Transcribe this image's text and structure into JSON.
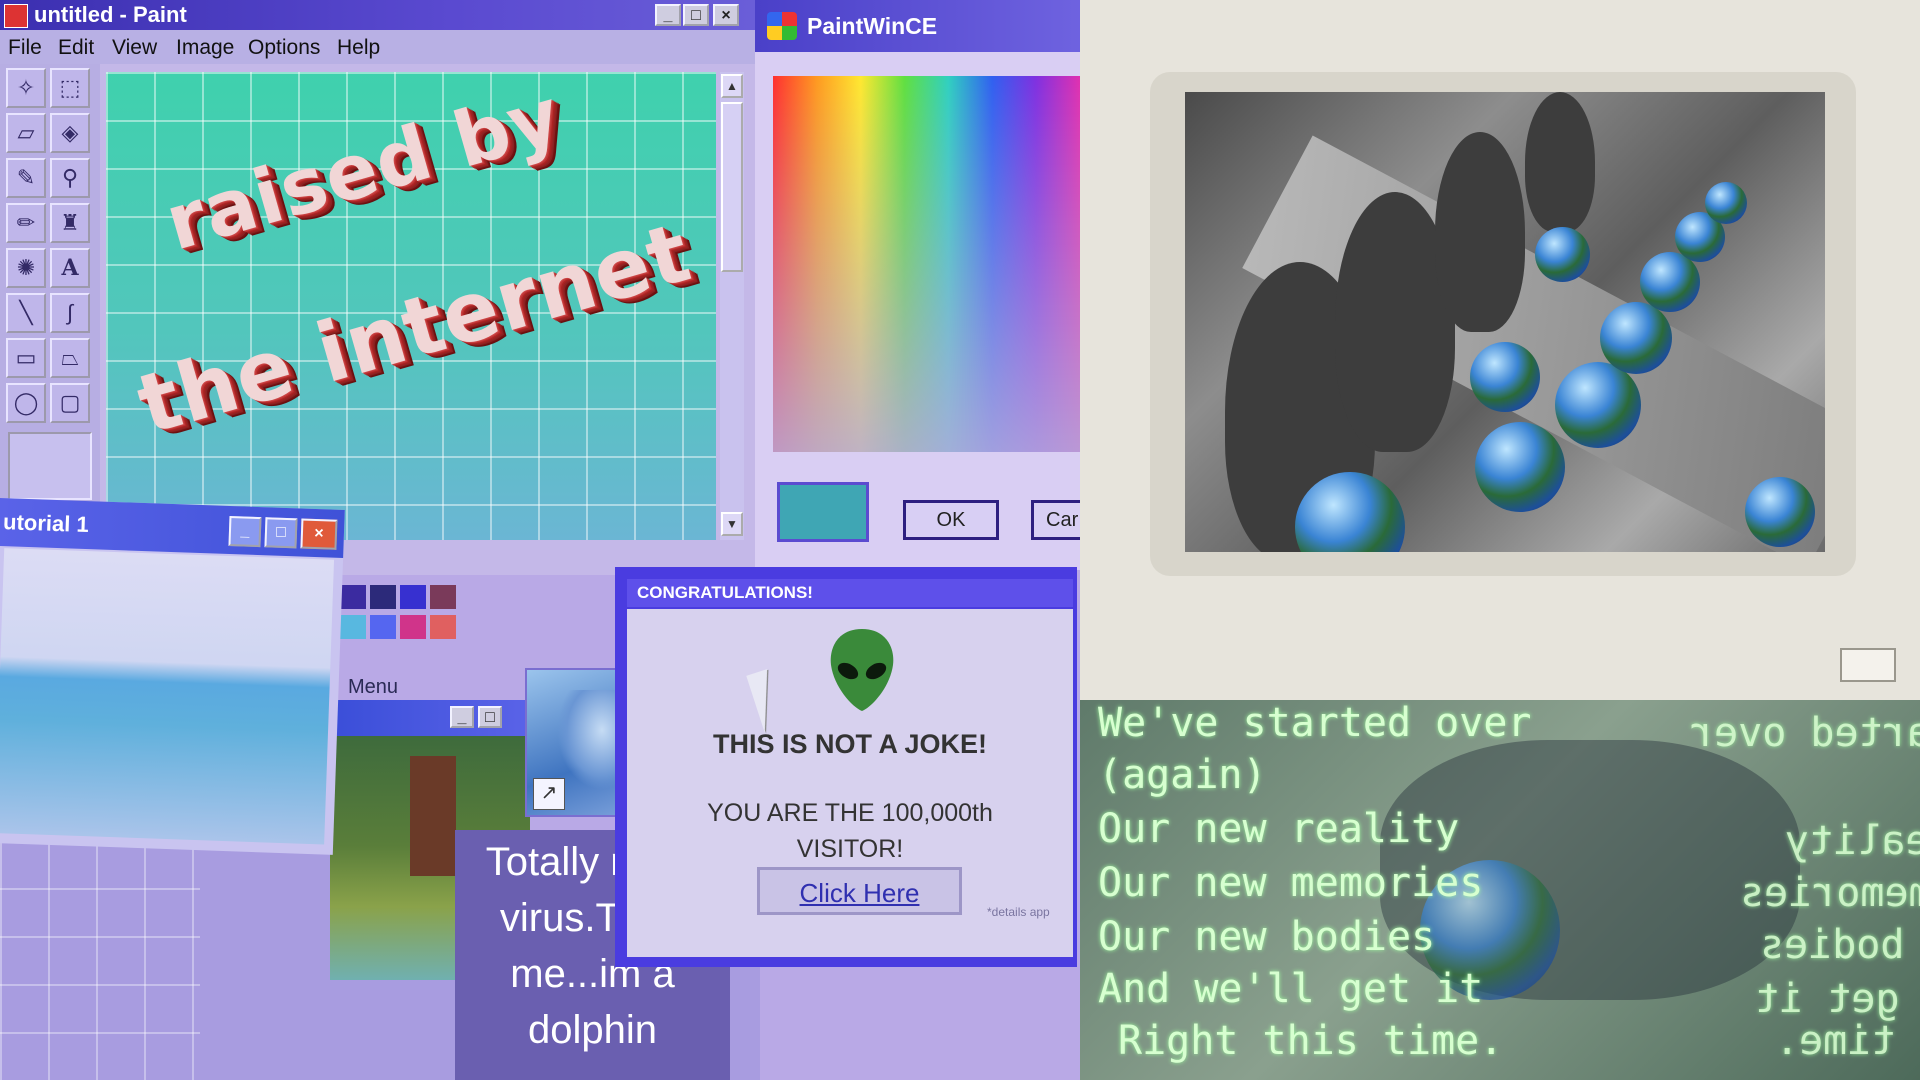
{
  "paint": {
    "title": "untitled - Paint",
    "menu": [
      "File",
      "Edit",
      "View",
      "Image",
      "Options",
      "Help"
    ],
    "tools": [
      "free-select",
      "rect-select",
      "eraser",
      "fill",
      "picker",
      "magnifier",
      "pencil",
      "brush",
      "airbrush",
      "text",
      "line",
      "curve",
      "rectangle",
      "polygon",
      "ellipse",
      "rounded-rect"
    ],
    "wordart_line1": "raised by",
    "wordart_line2": "the internet",
    "title_buttons": [
      "_",
      "□",
      "×"
    ]
  },
  "color_dialog": {
    "title": "PaintWinCE",
    "ok_label": "OK",
    "cancel_label": "Car",
    "selected_color": "#3fa6b4"
  },
  "tutorial": {
    "title": "utorial 1",
    "buttons": [
      "_",
      "□",
      "×"
    ]
  },
  "menu_fragment": "Menu",
  "dolphin_note": [
    "Totally not a",
    "virus.Trust",
    "me...im a",
    "dolphin"
  ],
  "congrats": {
    "title": "CONGRATULATIONS!",
    "headline": "THIS IS NOT A JOKE!",
    "line1": "YOU ARE THE 100,000th",
    "line2": "VISITOR!",
    "button": "Click Here",
    "footnote": "*details app"
  },
  "poem": {
    "lines": [
      "We've started over",
      "(again)",
      "Our new reality",
      "Our new memories",
      "Our new bodies",
      "And we'll get it",
      "Right this time."
    ],
    "mirrored": [
      "started over",
      "reality",
      "memories",
      "bodies",
      "get it",
      "time."
    ]
  },
  "colors": {
    "accent_blue": "#4a3ce0",
    "canvas_teal": "#48cbb5",
    "terminal_text": "#d7ffd0"
  }
}
